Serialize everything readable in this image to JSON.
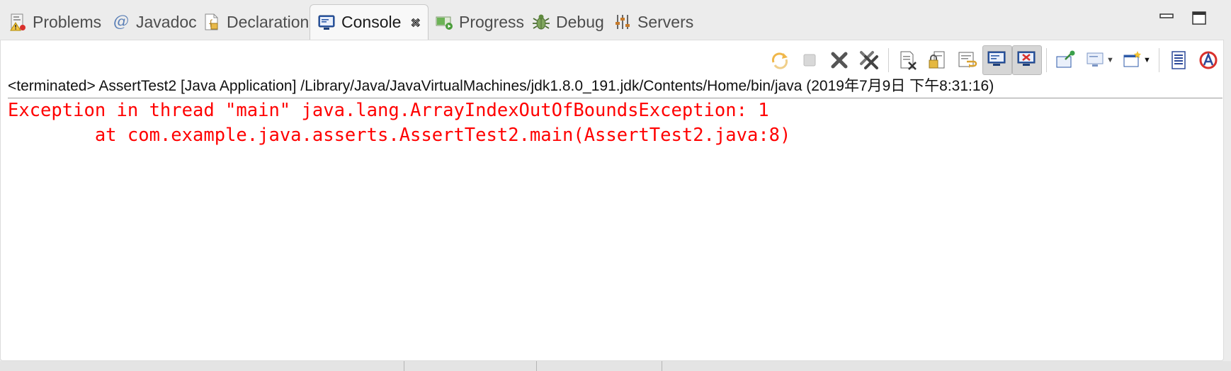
{
  "tabs": [
    {
      "label": "Problems",
      "icon": "problems-icon",
      "active": false
    },
    {
      "label": "Javadoc",
      "icon": "javadoc-icon",
      "active": false
    },
    {
      "label": "Declaration",
      "icon": "declaration-icon",
      "active": false
    },
    {
      "label": "Console",
      "icon": "console-icon",
      "active": true
    },
    {
      "label": "Progress",
      "icon": "progress-icon",
      "active": false
    },
    {
      "label": "Debug",
      "icon": "debug-icon",
      "active": false
    },
    {
      "label": "Servers",
      "icon": "servers-icon",
      "active": false
    }
  ],
  "window_controls": [
    "minimize-icon",
    "maximize-icon"
  ],
  "toolbar": {
    "buttons": [
      "relaunch-icon",
      "terminate-icon",
      "remove-launch-icon",
      "remove-all-terminated-icon",
      "clear-console-icon",
      "scroll-lock-icon",
      "word-wrap-icon",
      "show-on-stdout-icon",
      "show-on-stderr-icon",
      "pin-console-icon",
      "display-selected-console-icon",
      "open-console-icon",
      "toggle-view-icon",
      "run-stop-icon"
    ],
    "pressed": [
      "show-on-stdout-icon",
      "show-on-stderr-icon"
    ]
  },
  "console": {
    "status": "<terminated> AssertTest2 [Java Application] /Library/Java/JavaVirtualMachines/jdk1.8.0_191.jdk/Contents/Home/bin/java (2019年7月9日 下午8:31:16)",
    "output": [
      "Exception in thread \"main\" java.lang.ArrayIndexOutOfBoundsException: 1",
      "\tat com.example.java.asserts.AssertTest2.main(AssertTest2.java:8)"
    ]
  },
  "colors": {
    "stderr": "#ff0000",
    "background": "#ececec",
    "panel": "#ffffff"
  }
}
